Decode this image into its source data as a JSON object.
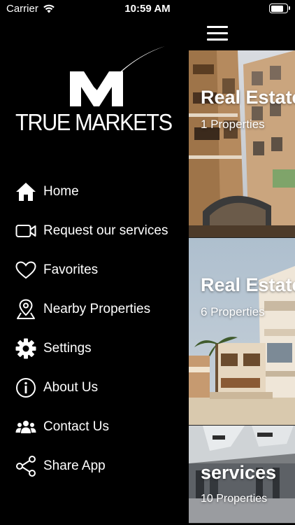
{
  "status_bar": {
    "carrier": "Carrier",
    "time": "10:59 AM",
    "battery_level": 0.8
  },
  "drawer": {
    "logo_text": "TRUE MARKETS",
    "menu": [
      {
        "label": "Home",
        "icon": "home-icon"
      },
      {
        "label": "Request our services",
        "icon": "video-camera-icon"
      },
      {
        "label": "Favorites",
        "icon": "heart-icon"
      },
      {
        "label": "Nearby Properties",
        "icon": "map-pin-icon"
      },
      {
        "label": "Settings",
        "icon": "gear-icon"
      },
      {
        "label": "About Us",
        "icon": "info-icon"
      },
      {
        "label": "Contact Us",
        "icon": "group-icon"
      },
      {
        "label": "Share App",
        "icon": "share-icon"
      }
    ]
  },
  "main": {
    "menu_icon": "hamburger-icon",
    "cards": [
      {
        "title": "Real Estate",
        "subtitle": "1 Properties"
      },
      {
        "title": "Real Estate",
        "subtitle": "6 Properties"
      },
      {
        "title": "services",
        "subtitle": "10 Properties"
      }
    ]
  },
  "colors": {
    "background": "#000000",
    "text": "#ffffff"
  }
}
